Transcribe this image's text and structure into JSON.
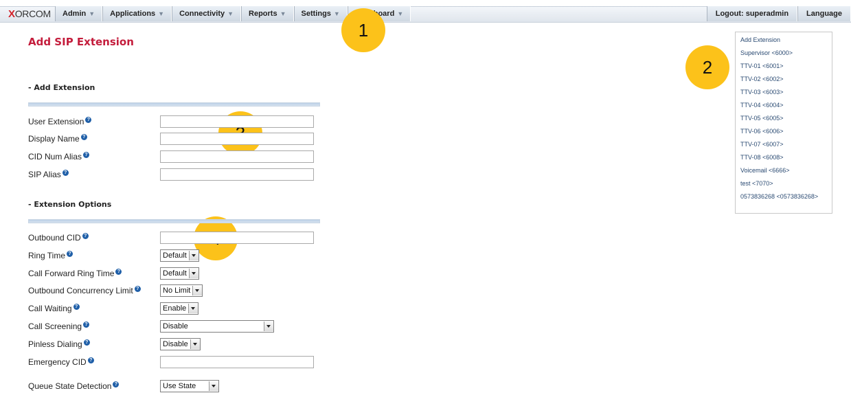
{
  "logo_text": "XORCOM",
  "nav": {
    "items": [
      {
        "label": "Admin"
      },
      {
        "label": "Applications"
      },
      {
        "label": "Connectivity"
      },
      {
        "label": "Reports"
      },
      {
        "label": "Settings"
      },
      {
        "label": "Dashboard"
      }
    ],
    "logout": "Logout: superadmin",
    "language": "Language"
  },
  "markers": [
    "1",
    "2",
    "3",
    "4"
  ],
  "page_title": "Add SIP Extension",
  "sections": {
    "add_extension": "- Add Extension",
    "extension_options": "- Extension Options"
  },
  "fields": {
    "user_extension": "User Extension",
    "display_name": "Display Name",
    "cid_num_alias": "CID Num Alias",
    "sip_alias": "SIP Alias",
    "outbound_cid": "Outbound CID",
    "ring_time": "Ring Time",
    "call_forward_ring_time": "Call Forward Ring Time",
    "outbound_concurrency_limit": "Outbound Concurrency Limit",
    "call_waiting": "Call Waiting",
    "call_screening": "Call Screening",
    "pinless_dialing": "Pinless Dialing",
    "emergency_cid": "Emergency CID",
    "queue_state_detection": "Queue State Detection"
  },
  "selects": {
    "ring_time": "Default",
    "call_forward_ring_time": "Default",
    "outbound_concurrency_limit": "No Limit",
    "call_waiting": "Enable",
    "call_screening": "Disable",
    "pinless_dialing": "Disable",
    "queue_state_detection": "Use State"
  },
  "extension_list": [
    "Add Extension",
    "Supervisor <6000>",
    "TTV-01 <6001>",
    "TTV-02 <6002>",
    "TTV-03 <6003>",
    "TTV-04 <6004>",
    "TTV-05 <6005>",
    "TTV-06 <6006>",
    "TTV-07 <6007>",
    "TTV-08 <6008>",
    "Voicemail <6666>",
    "test <7070>",
    "0573836268 <0573836268>"
  ],
  "colors": {
    "title": "#c41d3c",
    "marker": "#fcc21a",
    "link": "#2a4a72"
  }
}
